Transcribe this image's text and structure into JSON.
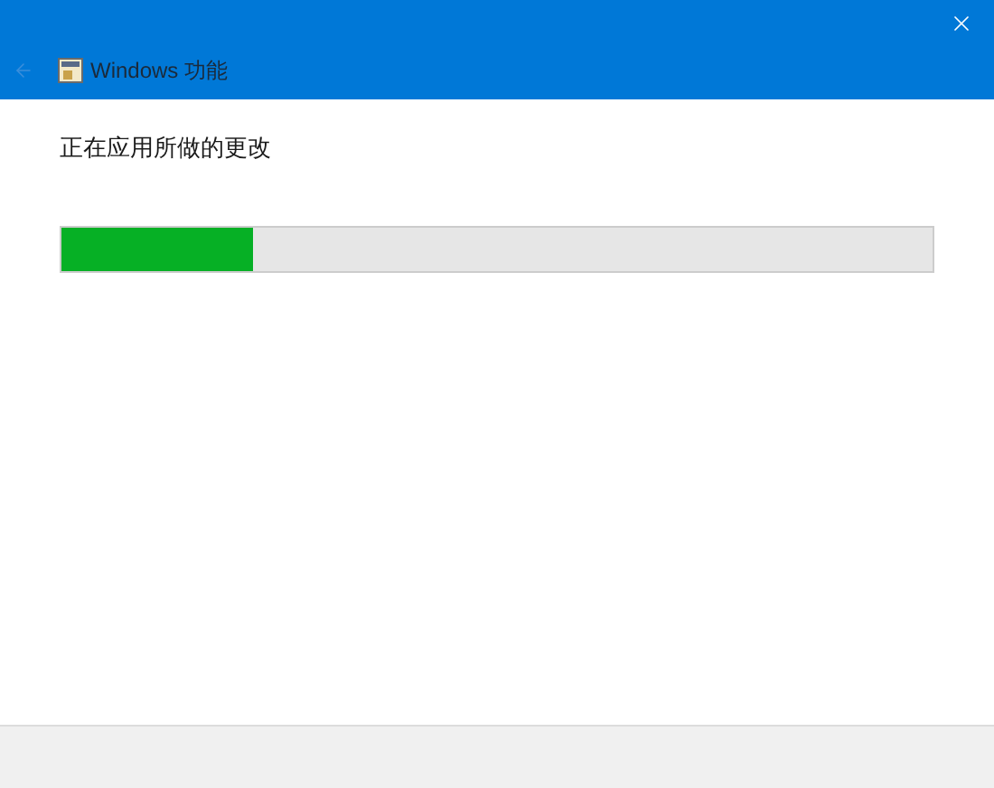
{
  "window": {
    "title": "Windows 功能",
    "back_button": {
      "disabled": true
    }
  },
  "status": "正在应用所做的更改",
  "progress": {
    "level": 0.22
  }
}
